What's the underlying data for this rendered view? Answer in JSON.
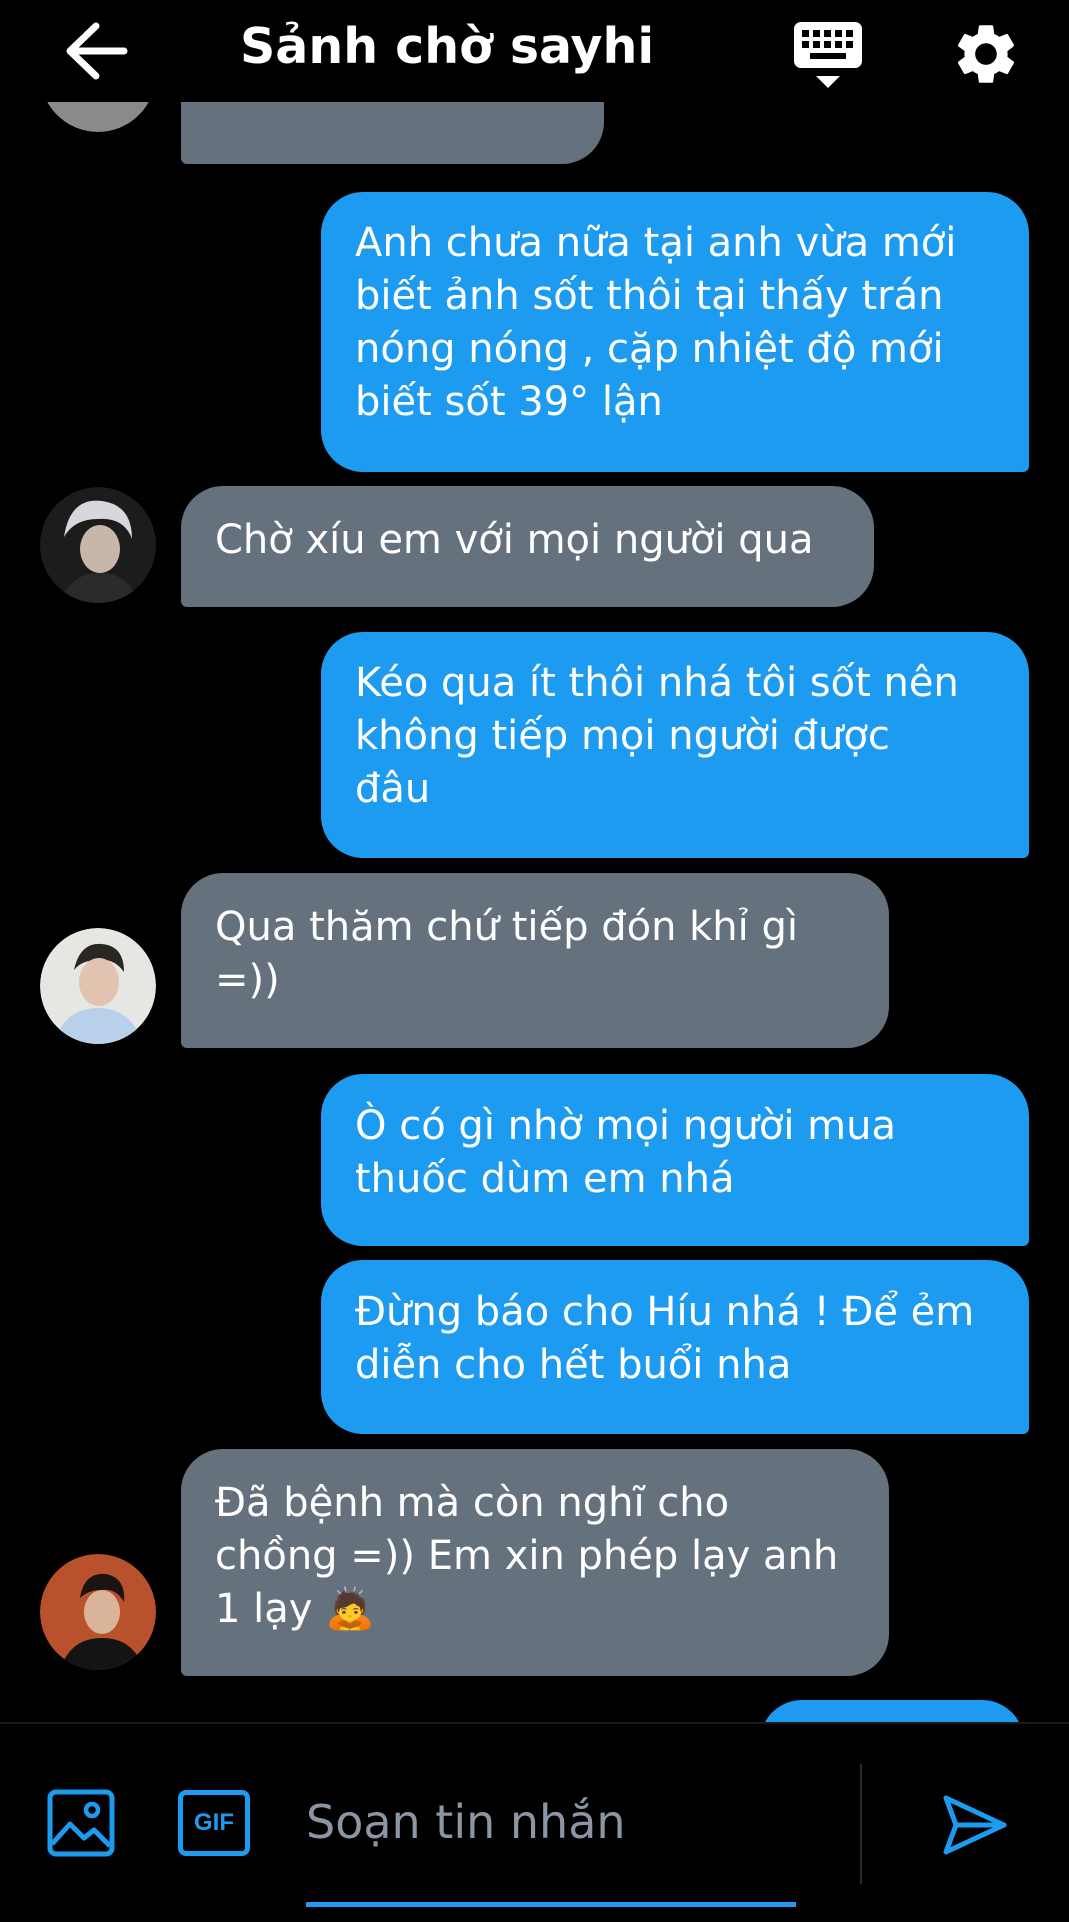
{
  "header": {
    "title": "Sảnh chờ sayhi"
  },
  "icons": {
    "back": "arrow-left-icon",
    "keyboard": "keyboard-icon",
    "settings": "gear-icon",
    "image": "image-icon",
    "gif": "gif-icon",
    "send": "send-icon"
  },
  "messages": [
    {
      "direction": "in",
      "text": ""
    },
    {
      "direction": "out",
      "text": "Anh chưa nữa tại anh vừa mới\nbiết ảnh sốt thôi tại thấy trán\nnóng nóng , cặp nhiệt độ mới\nbiết sốt 39° lận"
    },
    {
      "direction": "in",
      "text": "Chờ xíu em với mọi người qua"
    },
    {
      "direction": "out",
      "text": "Kéo qua ít thôi nhá tôi sốt nên\nkhông tiếp mọi người được\nđâu"
    },
    {
      "direction": "in",
      "text": "Qua thăm chứ tiếp đón khỉ gì\n=))"
    },
    {
      "direction": "out",
      "text": "Ò có gì nhờ mọi người mua\nthuốc dùm em nhá"
    },
    {
      "direction": "out",
      "text": "Đừng báo cho Híu nhá ! Để ẻm\ndiễn cho hết buổi nha"
    },
    {
      "direction": "in",
      "text": "Đã bệnh mà còn nghĩ cho\nchồng =)) Em xin phép lạy anh\n1 lạy 🙇"
    },
    {
      "direction": "out",
      "text": ""
    }
  ],
  "composer": {
    "gif_label": "GIF",
    "placeholder": "Soạn tin nhắn",
    "value": ""
  },
  "colors": {
    "background": "#000000",
    "outgoing_bubble": "#1d9bf0",
    "incoming_bubble": "#66717e",
    "accent": "#1d9bf0"
  }
}
